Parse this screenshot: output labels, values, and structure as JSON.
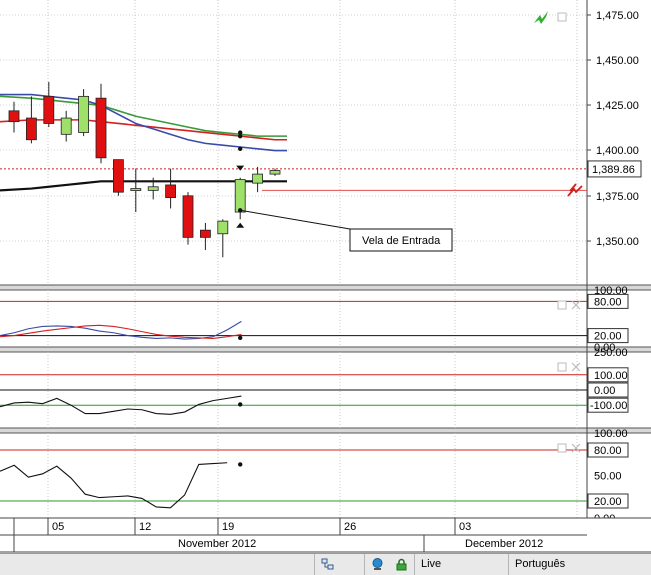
{
  "chart_data": [
    {
      "type": "candlestick",
      "panel": "price",
      "y_ticks": [
        "1,475.00",
        "1,450.00",
        "1,425.00",
        "1,400.00",
        "1,375.00",
        "1,350.00"
      ],
      "ylim": [
        1325,
        1485
      ],
      "current_price": 1389.86,
      "current_price_label": "1,389.86",
      "alert_level": 1378,
      "candles": [
        {
          "open": 1422,
          "high": 1427,
          "low": 1410,
          "close": 1416
        },
        {
          "open": 1418,
          "high": 1430,
          "low": 1404,
          "close": 1406
        },
        {
          "open": 1430,
          "high": 1438,
          "low": 1413,
          "close": 1415
        },
        {
          "open": 1409,
          "high": 1422,
          "low": 1405,
          "close": 1418
        },
        {
          "open": 1410,
          "high": 1434,
          "low": 1408,
          "close": 1430
        },
        {
          "open": 1429,
          "high": 1437,
          "low": 1393,
          "close": 1396
        },
        {
          "open": 1395,
          "high": 1392,
          "low": 1375,
          "close": 1377
        },
        {
          "open": 1378,
          "high": 1390,
          "low": 1366,
          "close": 1379
        },
        {
          "open": 1378,
          "high": 1385,
          "low": 1373,
          "close": 1380
        },
        {
          "open": 1381,
          "high": 1390,
          "low": 1368,
          "close": 1374
        },
        {
          "open": 1375,
          "high": 1377,
          "low": 1348,
          "close": 1352
        },
        {
          "open": 1356,
          "high": 1360,
          "low": 1345,
          "close": 1352
        },
        {
          "open": 1354,
          "high": 1362,
          "low": 1341,
          "close": 1361
        },
        {
          "open": 1366,
          "high": 1385,
          "low": 1362,
          "close": 1384
        },
        {
          "open": 1382,
          "high": 1391,
          "low": 1377,
          "close": 1387
        },
        {
          "open": 1387,
          "high": 1390,
          "low": 1386,
          "close": 1389
        }
      ],
      "series": [
        {
          "name": "",
          "color": "#d42020",
          "values": [
            1416,
            1417,
            1417,
            1417,
            1417,
            1416,
            1415,
            1414,
            1413,
            1412,
            1411,
            1410,
            1409,
            1408,
            1407,
            1406
          ]
        },
        {
          "name": "",
          "color": "#3a9a3a",
          "values": [
            1430,
            1429,
            1428,
            1427,
            1426,
            1425,
            1422,
            1419,
            1417,
            1415,
            1413,
            1411,
            1410,
            1409,
            1408,
            1408
          ]
        },
        {
          "name": "",
          "color": "#3a4aa8",
          "values": [
            1431,
            1431,
            1430,
            1429,
            1428,
            1425,
            1420,
            1415,
            1412,
            1409,
            1406,
            1404,
            1403,
            1402,
            1401,
            1400
          ]
        },
        {
          "name": "",
          "color": "#111111",
          "values": [
            1378,
            1379,
            1380,
            1381,
            1382,
            1383,
            1383,
            1383,
            1383,
            1383,
            1383,
            1383,
            1383,
            1383,
            1383,
            1383
          ]
        }
      ],
      "markers": [
        {
          "bar": 13,
          "type": "triangle-down",
          "price": 1390
        },
        {
          "bar": 13,
          "type": "triangle-up",
          "price": 1359
        },
        {
          "bar": 13,
          "type": "dot",
          "price": 1367
        },
        {
          "bar": 13,
          "type": "dot",
          "price": 1410
        },
        {
          "bar": 13,
          "type": "dot",
          "price": 1408
        },
        {
          "bar": 13,
          "type": "dot",
          "price": 1401
        }
      ],
      "annotation": {
        "text": "Vela de Entrada",
        "anchor_bar": 13,
        "anchor_price": 1367
      }
    },
    {
      "type": "line",
      "panel": "oscillator-1",
      "y_ticks": [
        "100.00",
        "80.00",
        "20.00",
        "0.00"
      ],
      "ylim": [
        0,
        100
      ],
      "levels": [
        {
          "value": 80,
          "color": "#cc2222"
        },
        {
          "value": 20,
          "color": "#111111"
        }
      ],
      "series": [
        {
          "name": "",
          "color": "#3a4aa8",
          "values": [
            20,
            25,
            32,
            36,
            37,
            36,
            33,
            28,
            25,
            20,
            17,
            15,
            16,
            14,
            15,
            18,
            30,
            45
          ]
        },
        {
          "name": "",
          "color": "#d42020",
          "values": [
            18,
            20,
            24,
            28,
            31,
            34,
            37,
            38,
            36,
            32,
            27,
            22,
            19,
            17,
            16,
            15,
            18,
            22
          ]
        }
      ],
      "markers": [
        {
          "bar": 13,
          "type": "dot",
          "value": 16
        }
      ]
    },
    {
      "type": "line",
      "panel": "oscillator-2",
      "y_ticks": [
        "250.00",
        "100.00",
        "0.00",
        "-100.00"
      ],
      "ylim": [
        -250,
        250
      ],
      "levels": [
        {
          "value": 100,
          "color": "#cc2222"
        },
        {
          "value": 0,
          "color": "#111111"
        },
        {
          "value": -100,
          "color": "#2a9a2a"
        }
      ],
      "series": [
        {
          "name": "",
          "color": "#111111",
          "values": [
            -110,
            -85,
            -80,
            -90,
            -55,
            -100,
            -155,
            -155,
            -140,
            -125,
            -130,
            -155,
            -160,
            -145,
            -95,
            -70,
            -55,
            -40
          ]
        }
      ],
      "markers": [
        {
          "bar": 13,
          "type": "dot",
          "value": -95
        }
      ]
    },
    {
      "type": "line",
      "panel": "oscillator-3",
      "y_ticks": [
        "100.00",
        "80.00",
        "50.00",
        "20.00",
        "0.00"
      ],
      "ylim": [
        0,
        100
      ],
      "levels": [
        {
          "value": 80,
          "color": "#cc2222"
        },
        {
          "value": 20,
          "color": "#2a9a2a"
        }
      ],
      "series": [
        {
          "name": "",
          "color": "#111111",
          "values": [
            55,
            62,
            48,
            52,
            61,
            47,
            28,
            24,
            25,
            26,
            23,
            13,
            12,
            27,
            63,
            64,
            65
          ]
        }
      ],
      "markers": [
        {
          "bar": 13,
          "type": "dot",
          "value": 63
        }
      ]
    }
  ],
  "x_axis": {
    "day_labels": [
      "05",
      "12",
      "19",
      "26",
      "03"
    ],
    "month_labels": [
      "November 2012",
      "December 2012"
    ]
  },
  "status_bar": {
    "connection": "Live",
    "language": "Português"
  }
}
